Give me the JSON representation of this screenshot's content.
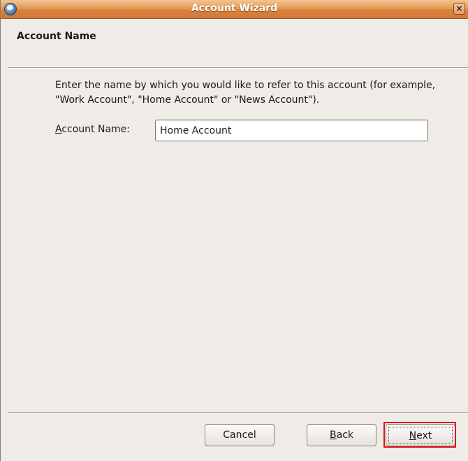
{
  "window": {
    "title": "Account Wizard",
    "close_glyph": "×",
    "app_icon": "thunderbird-icon"
  },
  "page": {
    "title": "Account Name",
    "description": "Enter the name by which you would like to refer to this account (for example, \"Work Account\", \"Home Account\" or \"News Account\")."
  },
  "form": {
    "account_name_label_mnemonic": "A",
    "account_name_label_rest": "ccount Name:",
    "account_name_value": "Home Account"
  },
  "buttons": {
    "cancel_label": "Cancel",
    "back_mnemonic": "B",
    "back_rest": "ack",
    "next_mnemonic": "N",
    "next_rest": "ext"
  },
  "colors": {
    "titlebar": "#d9823f",
    "highlight": "#d8191e",
    "window_bg": "#efebe7"
  }
}
